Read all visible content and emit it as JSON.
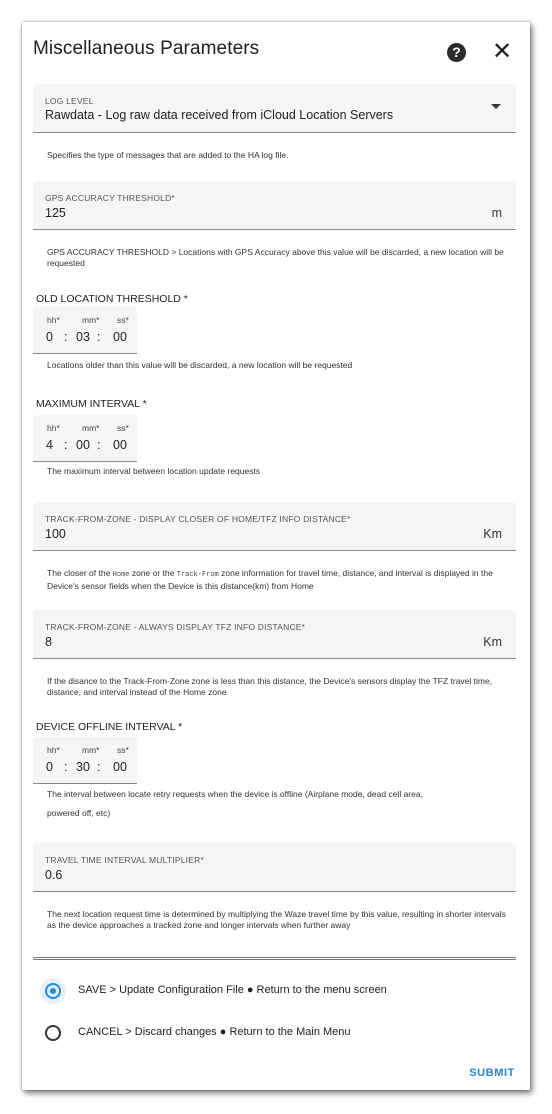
{
  "dialog": {
    "title": "Miscellaneous Parameters",
    "help_icon": "?",
    "close_icon": "✕"
  },
  "log_level": {
    "label": "LOG LEVEL",
    "value": "Rawdata - Log raw data received from iCloud Location Servers",
    "helper": "Specifies the type of messages that are added to the HA log file."
  },
  "gps_accuracy": {
    "label": "GPS ACCURACY THRESHOLD*",
    "value": "125",
    "suffix": "m",
    "helper": "GPS ACCURACY THRESHOLD > Locations with GPS Accuracy above this value will be discarded, a new location will be requested"
  },
  "old_location": {
    "label": "OLD LOCATION THRESHOLD *",
    "hh_label": "hh*",
    "mm_label": "mm*",
    "ss_label": "ss*",
    "hh": "0",
    "mm": "03",
    "ss": "00",
    "sep": ":",
    "helper": "Locations older than this value will be discarded, a new location will be requested"
  },
  "max_interval": {
    "label": "MAXIMUM INTERVAL *",
    "hh_label": "hh*",
    "mm_label": "mm*",
    "ss_label": "ss*",
    "hh": "4",
    "mm": "00",
    "ss": "00",
    "sep": ":",
    "helper": "The maximum interval between location update requests"
  },
  "tfz_closer": {
    "label": "TRACK-FROM-ZONE - DISPLAY CLOSER OF HOME/TFZ INFO DISTANCE*",
    "value": "100",
    "suffix": "Km",
    "helper_a": "The closer of the ",
    "helper_code1": "Home",
    "helper_b": " zone or the ",
    "helper_code2": "Track-From",
    "helper_c": " zone information for travel time, distance, and interval is displayed in the Device's sensor fields when the Device is this distance(km) from Home"
  },
  "tfz_always": {
    "label": "TRACK-FROM-ZONE - ALWAYS DISPLAY TFZ INFO DISTANCE*",
    "value": "8",
    "suffix": "Km",
    "helper": "If the disance to the Track-From-Zone zone is less than this distance, the Device's sensors display the TFZ travel time, distance, and interval instead of the Home zone"
  },
  "offline_interval": {
    "label": "DEVICE OFFLINE INTERVAL *",
    "hh_label": "hh*",
    "mm_label": "mm*",
    "ss_label": "ss*",
    "hh": "0",
    "mm": "30",
    "ss": "00",
    "sep": ":",
    "helper_1": "The interval between locate retry requests when the device is offline (Airplane mode, dead cell area,",
    "helper_2": "powered off, etc)"
  },
  "travel_multiplier": {
    "label": "TRAVEL TIME INTERVAL MULTIPLIER*",
    "value": "0.6",
    "helper": "The next location request time is determined by multiplying the Waze travel time by this value, resulting in shorter intervals as the device approaches a tracked zone and longer intervals when further away"
  },
  "actions": {
    "save_label": "SAVE > Update Configuration File ● Return to the menu screen",
    "cancel_label": "CANCEL > Discard changes ● Return to the Main Menu",
    "selected": "save",
    "submit_label": "SUBMIT"
  },
  "colors": {
    "accent": "#1e88e5",
    "field_bg": "#f5f5f5"
  }
}
